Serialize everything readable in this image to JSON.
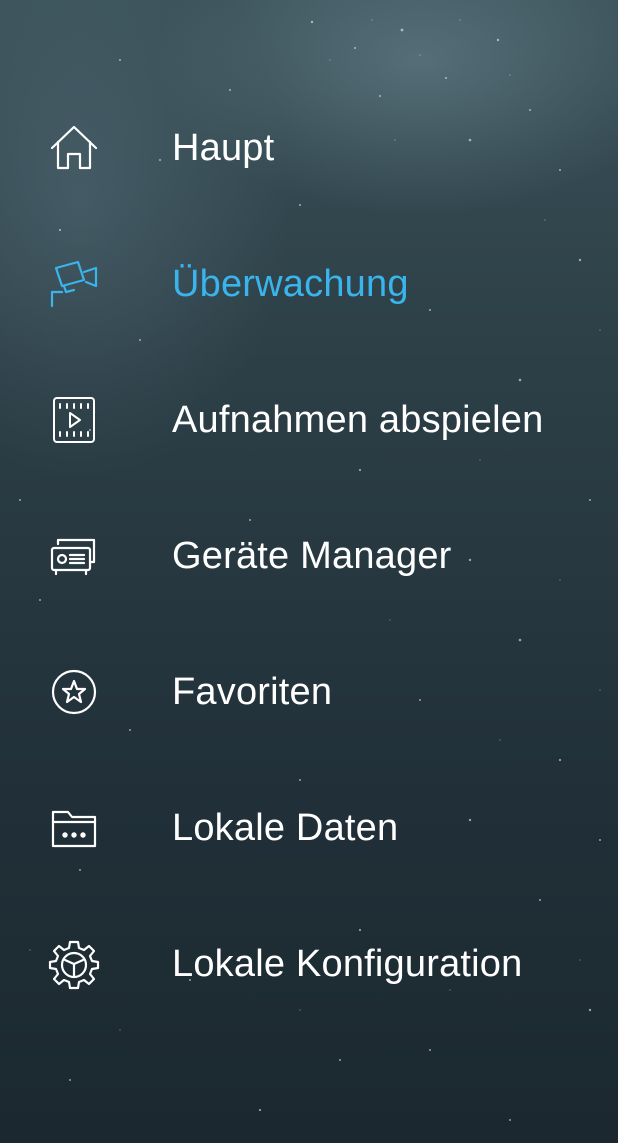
{
  "accent_color": "#3ab4ec",
  "text_color": "#ffffff",
  "menu": {
    "items": [
      {
        "label": "Haupt",
        "icon": "home-icon",
        "active": false
      },
      {
        "label": "Überwachung",
        "icon": "security-camera-icon",
        "active": true
      },
      {
        "label": "Aufnahmen abspielen",
        "icon": "video-playback-icon",
        "active": false
      },
      {
        "label": "Geräte Manager",
        "icon": "device-recorder-icon",
        "active": false
      },
      {
        "label": "Favoriten",
        "icon": "star-circle-icon",
        "active": false
      },
      {
        "label": "Lokale Daten",
        "icon": "folder-icon",
        "active": false
      },
      {
        "label": "Lokale Konfiguration",
        "icon": "gear-icon",
        "active": false
      }
    ]
  }
}
